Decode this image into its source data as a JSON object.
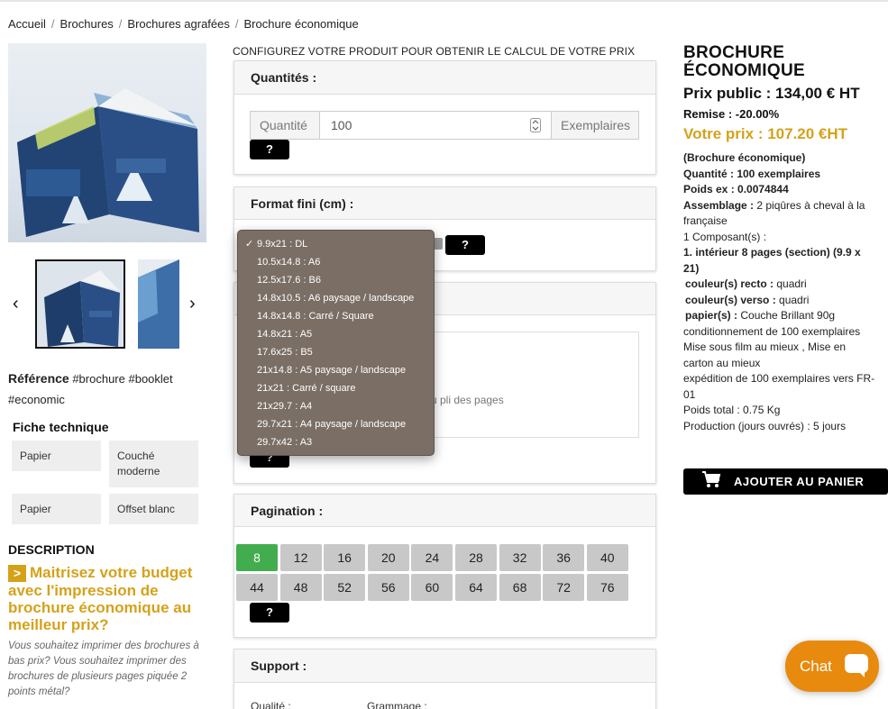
{
  "breadcrumb": [
    "Accueil",
    "Brochures",
    "Brochures agrafées",
    "Brochure économique"
  ],
  "left": {
    "main_image_alt": "",
    "reference_label": "Référence",
    "reference_tags": "#brochure #booklet #economic",
    "fiche_title": "Fiche technique",
    "fiche": [
      {
        "label": "Papier",
        "value": "Couché moderne"
      },
      {
        "label": "Papier",
        "value": "Offset blanc"
      }
    ],
    "description_title": "DESCRIPTION",
    "description_head_marker": ">",
    "description_head": "Maitrisez votre budget avec l'impression de brochure économique au meilleur prix?",
    "description_text": "Vous souhaitez imprimer des brochures à bas prix?  Vous souhaitez imprimer des brochures de plusieurs pages piquée 2 points métal?"
  },
  "config": {
    "title": "CONFIGUREZ VOTRE PRODUIT POUR OBTENIR LE CALCUL DE VOTRE PRIX",
    "quantites_title": "Quantités :",
    "quantite_label": "Quantité",
    "quantite_value": "100",
    "exemplaires_label": "Exemplaires",
    "help_label": "?",
    "format_title": "Format fini (cm) :",
    "format_options": [
      "9.9x21 : DL",
      "10.5x14.8 : A6",
      "12.5x17.6 : B6",
      "14.8x10.5 : A6 paysage / landscape",
      "14.8x14.8 : Carré / Square",
      "14.8x21 : A5",
      "17.6x25 : B5",
      "21x14.8 : A5 paysage / landscape",
      "21x21 : Carré / square",
      "21x29.7 : A4",
      "29.7x21 : A4 paysage / landscape",
      "29.7x42 : A3"
    ],
    "format_selected_check": "✓",
    "hidden_text_fragment": "u pli des pages",
    "pagination_title": "Pagination :",
    "pagination": [
      "8",
      "12",
      "16",
      "20",
      "24",
      "28",
      "32",
      "36",
      "40",
      "44",
      "48",
      "52",
      "56",
      "60",
      "64",
      "68",
      "72",
      "76"
    ],
    "pagination_active": "8",
    "support_title": "Support :",
    "support_qualite": "Qualité :",
    "support_grammage": "Grammage :"
  },
  "right": {
    "title": "BROCHURE ÉCONOMIQUE",
    "prix_public": "Prix public : 134,00 € HT",
    "remise": "Remise : -20.00%",
    "votre_prix": "Votre prix : 107.20 €HT",
    "details": {
      "product": "(Brochure économique)",
      "quantite": "Quantité : 100 exemplaires",
      "poids_ex": "Poids ex : 0.0074844",
      "assemblage_label": "Assemblage :",
      "assemblage_value": " 2 piqûres à cheval à la française",
      "composants": "1 Composant(s) :",
      "interieur": "1. intérieur 8 pages (section) (9.9 x 21)",
      "recto_label": "couleur(s) recto :",
      "recto_value": " quadri",
      "verso_label": "couleur(s) verso :",
      "verso_value": " quadri",
      "papier_label": "papier(s) :",
      "papier_value": " Couche Brillant 90g",
      "conditionnement": "conditionnement de 100 exemplaires",
      "film": "Mise sous film au mieux , Mise en carton au mieux",
      "expedition": "expédition de 100 exemplaires vers FR-01",
      "poids_total": "Poids total : 0.75 Kg",
      "production": "Production (jours ouvrés) : 5 jours"
    },
    "cart_label": "AJOUTER AU PANIER"
  },
  "chat_label": "Chat",
  "colors": {
    "accent": "#d4a21a",
    "active_page": "#42ad4f",
    "chat": "#e88a0e"
  }
}
